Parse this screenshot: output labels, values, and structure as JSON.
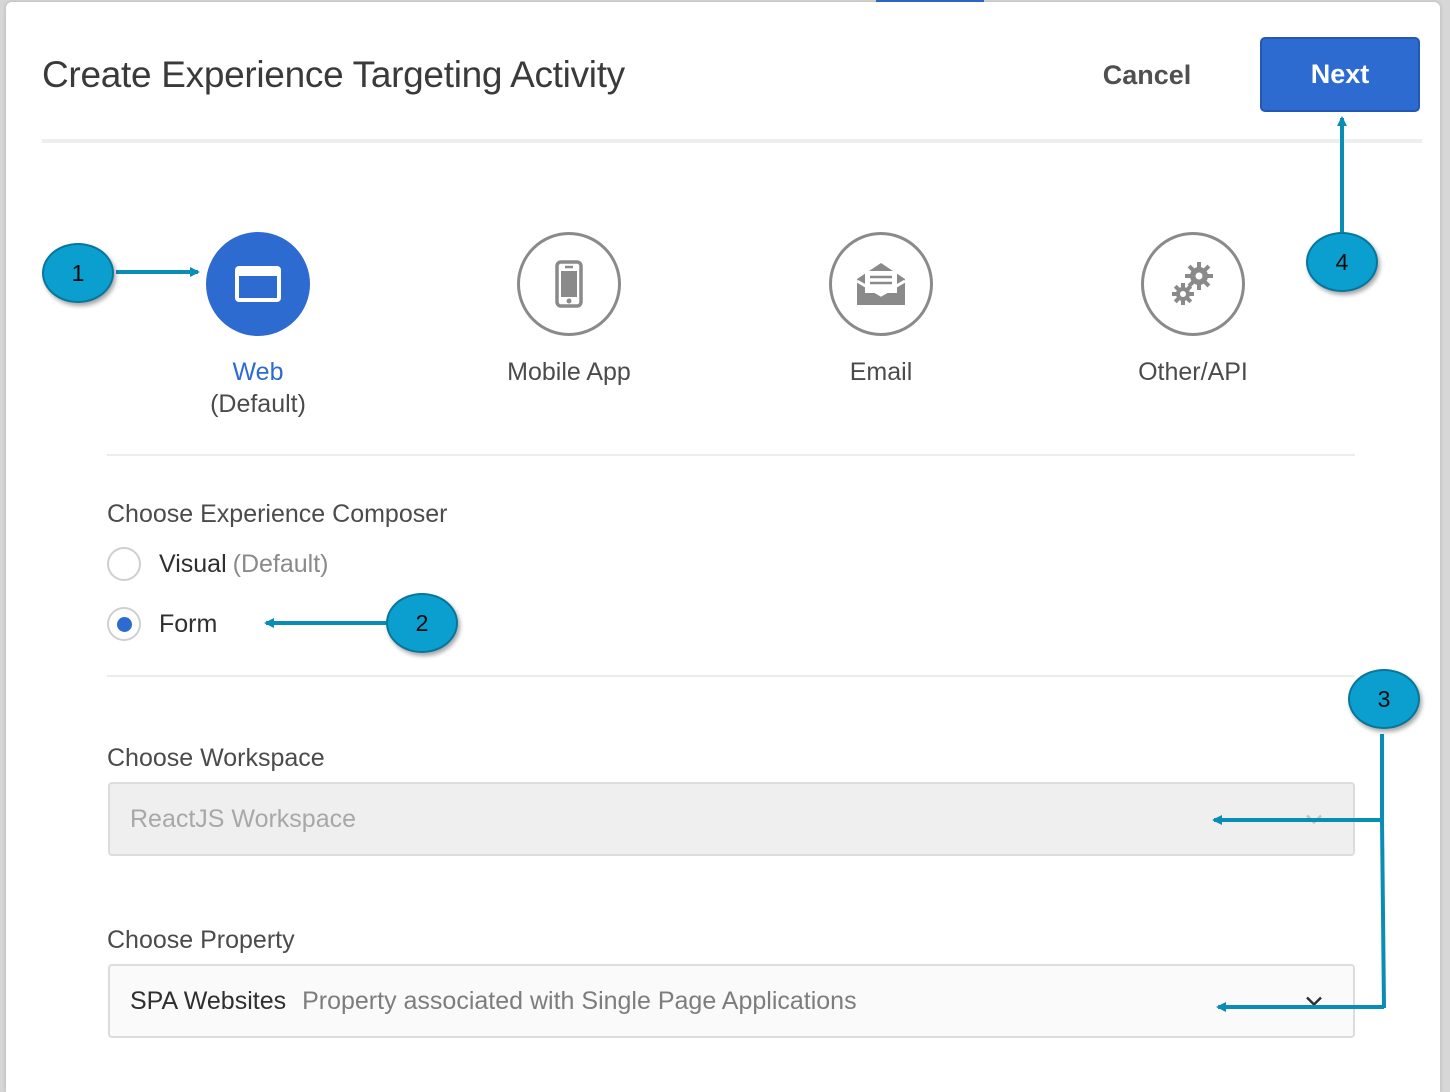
{
  "dialog": {
    "title": "Create Experience Targeting Activity",
    "cancel_label": "Cancel",
    "next_label": "Next"
  },
  "channels": [
    {
      "label": "Web",
      "sublabel": "(Default)",
      "icon": "browser-window-icon",
      "selected": true
    },
    {
      "label": "Mobile App",
      "sublabel": "",
      "icon": "mobile-phone-icon",
      "selected": false
    },
    {
      "label": "Email",
      "sublabel": "",
      "icon": "envelope-icon",
      "selected": false
    },
    {
      "label": "Other/API",
      "sublabel": "",
      "icon": "gears-icon",
      "selected": false
    }
  ],
  "composer": {
    "label": "Choose Experience Composer",
    "options": [
      {
        "label": "Visual",
        "hint": "(Default)",
        "selected": false
      },
      {
        "label": "Form",
        "hint": "",
        "selected": true
      }
    ]
  },
  "workspace": {
    "label": "Choose Workspace",
    "value": "ReactJS Workspace",
    "disabled": true
  },
  "property": {
    "label": "Choose Property",
    "value": "SPA Websites",
    "description": "Property associated with Single Page Applications"
  },
  "annotations": [
    "1",
    "2",
    "3",
    "4"
  ],
  "colors": {
    "accent": "#2d6bd1",
    "callout": "#0b9fcf",
    "arrow": "#0a8db5"
  }
}
